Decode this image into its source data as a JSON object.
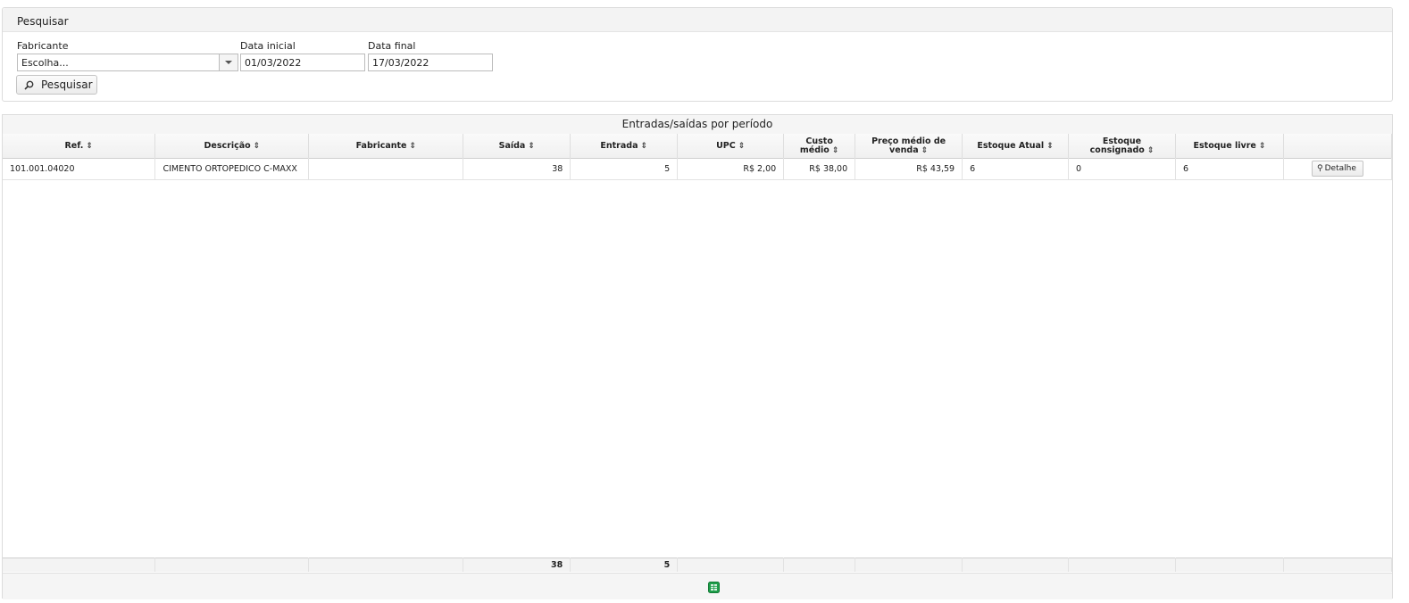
{
  "search": {
    "title": "Pesquisar",
    "manufacturer_label": "Fabricante",
    "manufacturer_value": "Escolha...",
    "start_date_label": "Data inicial",
    "start_date_value": "01/03/2022",
    "end_date_label": "Data final",
    "end_date_value": "17/03/2022",
    "button_label": "Pesquisar",
    "button_icon": "search-icon"
  },
  "grid": {
    "caption": "Entradas/saídas por período",
    "sort_icon": "sort-icon",
    "columns": [
      {
        "label": "Ref."
      },
      {
        "label": "Descrição"
      },
      {
        "label": "Fabricante"
      },
      {
        "label": "Saída"
      },
      {
        "label": "Entrada"
      },
      {
        "label": "UPC"
      },
      {
        "label": "Custo médio"
      },
      {
        "label": "Preço médio de venda"
      },
      {
        "label": "Estoque Atual"
      },
      {
        "label": "Estoque consignado"
      },
      {
        "label": "Estoque livre"
      },
      {
        "label": ""
      }
    ],
    "rows": [
      {
        "ref": "101.001.04020",
        "descricao": "CIMENTO ORTOPEDICO C-MAXX",
        "fabricante": "",
        "saida": "38",
        "entrada": "5",
        "upc": "R$ 2,00",
        "custo_medio": "R$ 38,00",
        "preco_medio": "R$ 43,59",
        "estoque_atual": "6",
        "estoque_consignado": "0",
        "estoque_livre": "6",
        "action_label": "Detalhe"
      }
    ],
    "footer": {
      "saida_total": "38",
      "entrada_total": "5"
    },
    "export_icon": "excel-export-icon",
    "export_color": "#1e9e4a"
  }
}
